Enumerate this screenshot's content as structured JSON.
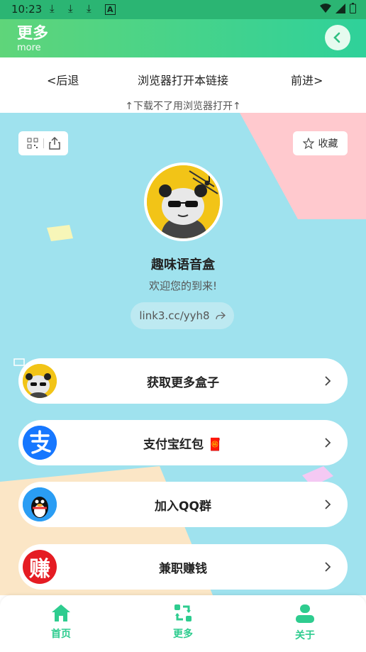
{
  "status": {
    "time": "10:23",
    "icons": [
      "download-icon",
      "download-icon",
      "download-icon",
      "a-icon"
    ]
  },
  "header": {
    "title": "更多",
    "subtitle": "more"
  },
  "nav": {
    "back": "<后退",
    "open_browser": "浏览器打开本链接",
    "forward": "前进>"
  },
  "hint": "↑下载不了用浏览器打开↑",
  "profile": {
    "favorite": "收藏",
    "name": "趣味语音盒",
    "welcome": "欢迎您的到来!",
    "link": "link3.cc/yyh8"
  },
  "buttons": [
    {
      "label": "获取更多盒子",
      "icon": "panda-avatar-icon"
    },
    {
      "label": "支付宝红包 🧧",
      "icon": "alipay-icon"
    },
    {
      "label": "加入QQ群",
      "icon": "qq-penguin-icon"
    },
    {
      "label": "兼职赚钱",
      "icon": "earn-icon",
      "icon_text": "赚"
    }
  ],
  "tabs": [
    {
      "label": "首页"
    },
    {
      "label": "更多"
    },
    {
      "label": "关于"
    }
  ],
  "colors": {
    "accent": "#2ecc8f",
    "background": "#9fe2ee"
  }
}
